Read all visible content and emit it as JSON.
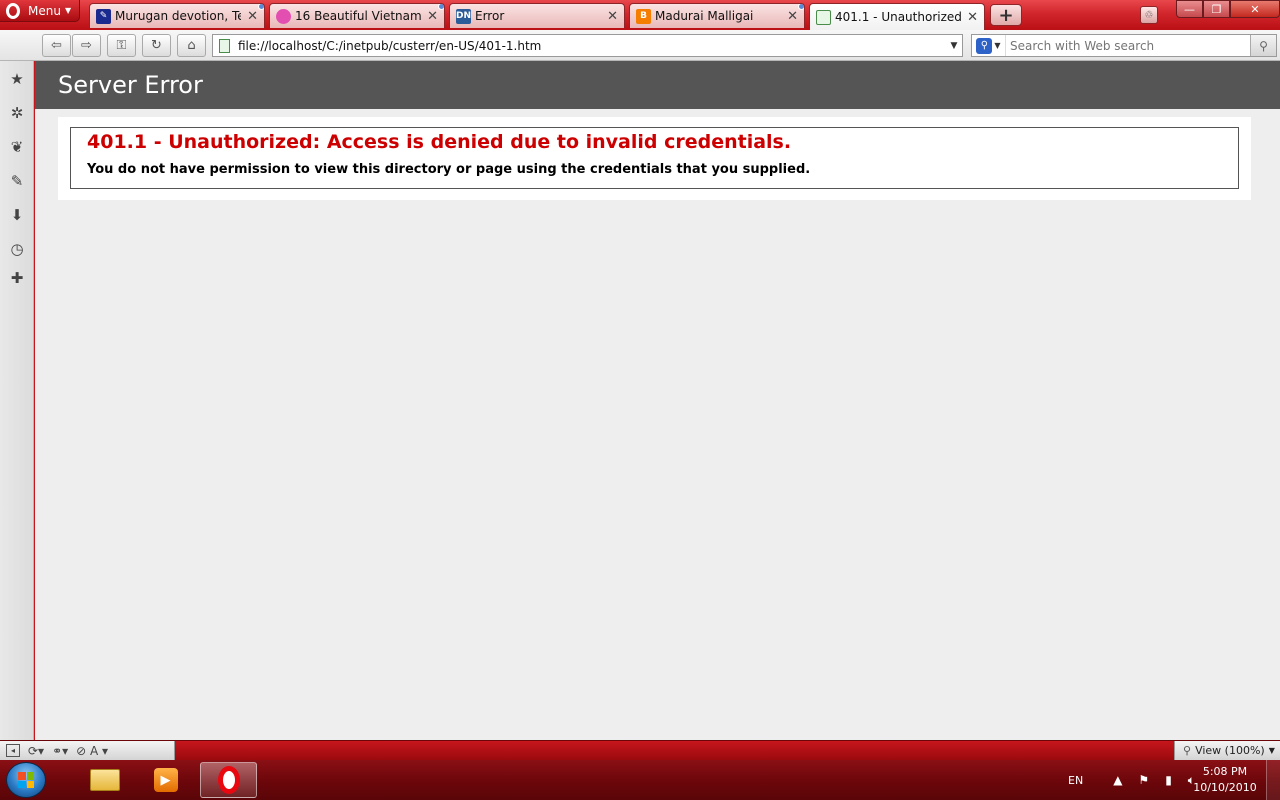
{
  "browser": {
    "menu_label": "Menu",
    "tabs": [
      {
        "title": "Murugan devotion, Te...",
        "favicon": "murugan-favicon",
        "favicon_color": "#1b2a8f"
      },
      {
        "title": "16 Beautiful Vietnam ......",
        "favicon": "flower-favicon",
        "favicon_color": "#e34fb0"
      },
      {
        "title": "Error",
        "favicon": "dn-favicon",
        "favicon_color": "#2b5c9a",
        "favicon_text": "DN"
      },
      {
        "title": "Madurai Malligai",
        "favicon": "blogger-favicon",
        "favicon_color": "#f57d00",
        "favicon_text": "B"
      },
      {
        "title": "401.1 - Unauthorized: ...",
        "favicon": "page-favicon",
        "favicon_color": "#e8f6e8",
        "active": true
      }
    ],
    "new_tab_icon": "+",
    "address": {
      "value": "file://localhost/C:/inetpub/custerr/en-US/401-1.htm"
    },
    "search": {
      "placeholder": "Search with Web search"
    },
    "status": {
      "view_label": "View (100%)"
    }
  },
  "page": {
    "header": "Server Error",
    "error_title": "401.1 - Unauthorized: Access is denied due to invalid credentials.",
    "error_message": "You do not have permission to view this directory or page using the credentials that you supplied."
  },
  "taskbar": {
    "language": "EN",
    "time": "5:08 PM",
    "date": "10/10/2010"
  },
  "colors": {
    "opera_red": "#c8151b",
    "header_bg": "#555555",
    "error_red": "#cc0000",
    "content_bg": "#eeeeee"
  }
}
